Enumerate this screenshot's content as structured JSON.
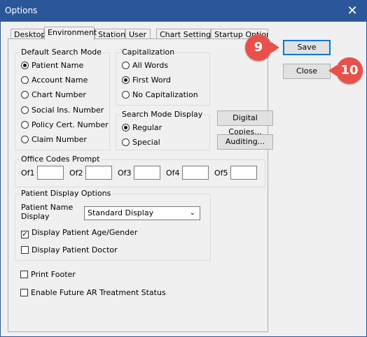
{
  "window": {
    "title": "Options",
    "close_glyph": "✕"
  },
  "tabs": [
    {
      "label": "Desktop",
      "active": false
    },
    {
      "label": "Environment",
      "active": true
    },
    {
      "label": "Station",
      "active": false
    },
    {
      "label": "User",
      "active": false
    },
    {
      "label": "Chart Settings",
      "active": false
    },
    {
      "label": "Startup Options",
      "active": false
    }
  ],
  "default_search_mode": {
    "label": "Default Search Mode",
    "options": [
      "Patient Name",
      "Account Name",
      "Chart Number",
      "Social Ins. Number",
      "Policy Cert. Number",
      "Claim Number"
    ],
    "selected": "Patient Name"
  },
  "capitalization": {
    "label": "Capitalization",
    "options": [
      "All Words",
      "First Word",
      "No Capitalization"
    ],
    "selected": "First Word"
  },
  "search_mode_display": {
    "label": "Search Mode Display",
    "options": [
      "Regular",
      "Special"
    ],
    "selected": "Regular"
  },
  "buttons": {
    "digital_copies": "Digital Copies...",
    "auditing": "Auditing...",
    "save": "Save",
    "close": "Close"
  },
  "office_codes": {
    "label": "Office Codes Prompt",
    "fields": [
      {
        "label": "Of1",
        "value": ""
      },
      {
        "label": "Of2",
        "value": ""
      },
      {
        "label": "Of3",
        "value": ""
      },
      {
        "label": "Of4",
        "value": ""
      },
      {
        "label": "Of5",
        "value": ""
      }
    ]
  },
  "patient_display": {
    "label": "Patient Display Options",
    "name_display_label_line1": "Patient Name",
    "name_display_label_line2": "Display",
    "name_display_value": "Standard Display",
    "show_age_gender": {
      "label": "Display Patient Age/Gender",
      "checked": true
    },
    "show_doctor": {
      "label": "Display Patient Doctor",
      "checked": false
    }
  },
  "print_footer": {
    "label": "Print  Footer",
    "checked": false
  },
  "future_ar": {
    "label": "Enable Future AR Treatment Status",
    "checked": false
  },
  "badges": {
    "save_step": "9",
    "close_step": "10"
  },
  "colors": {
    "titlebar": "#2b579a",
    "badge": "#e8514a",
    "focus": "#0078d7"
  }
}
